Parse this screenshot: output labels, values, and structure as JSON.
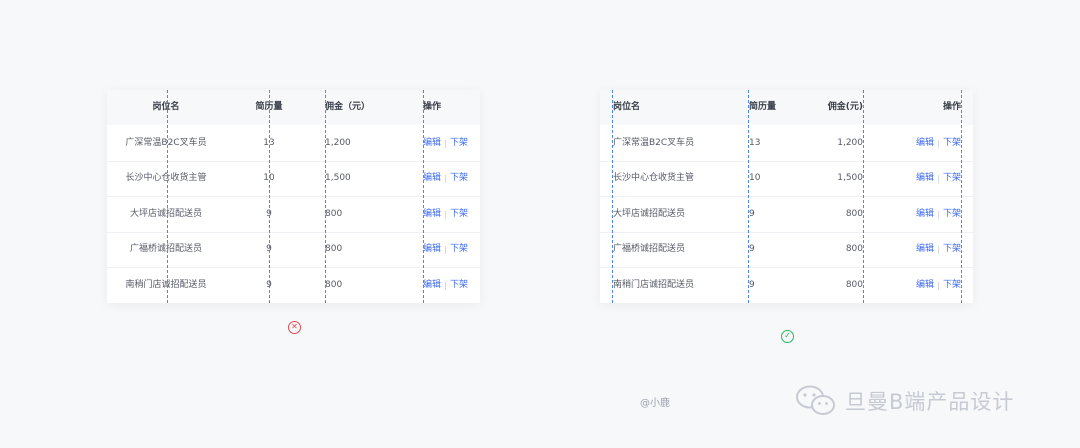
{
  "headers": {
    "name": "岗位名",
    "resumes": "简历量",
    "commission": "佣金（元）",
    "action": "操作"
  },
  "headers_good": {
    "commission": "佣金(元)"
  },
  "rows": [
    {
      "name": "广深常温B2C叉车员",
      "resumes": "13",
      "commission": "1,200"
    },
    {
      "name": "长沙中心仓收货主管",
      "resumes": "10",
      "commission": "1,500"
    },
    {
      "name": "大坪店诚招配送员",
      "resumes": "9",
      "commission": "800"
    },
    {
      "name": "广福桥诚招配送员",
      "resumes": "9",
      "commission": "800"
    },
    {
      "name": "南稍门店诚招配送员",
      "resumes": "9",
      "commission": "800"
    }
  ],
  "action_labels": {
    "edit": "编辑",
    "offline": "下架"
  },
  "status": {
    "bad_symbol": "✕",
    "good_symbol": "✓"
  },
  "credit": "@小鹿",
  "brand": "旦曼B端产品设计",
  "colors": {
    "link": "#3d6bf5",
    "guide": "#4c86f0",
    "bad": "#e5484d",
    "good": "#30b25b"
  }
}
